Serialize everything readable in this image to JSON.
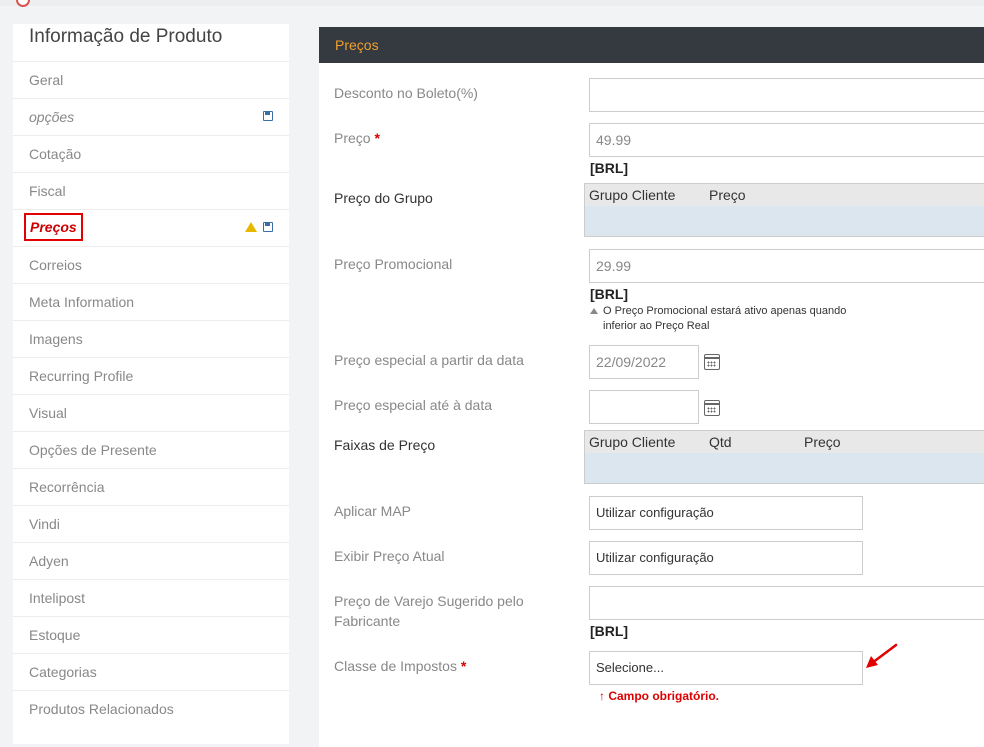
{
  "sidebar": {
    "title": "Informação de Produto",
    "items": [
      {
        "label": "Geral"
      },
      {
        "label": "opções"
      },
      {
        "label": "Cotação"
      },
      {
        "label": "Fiscal"
      },
      {
        "label": "Preços"
      },
      {
        "label": "Correios"
      },
      {
        "label": "Meta Information"
      },
      {
        "label": "Imagens"
      },
      {
        "label": "Recurring Profile"
      },
      {
        "label": "Visual"
      },
      {
        "label": "Opções de Presente"
      },
      {
        "label": "Recorrência"
      },
      {
        "label": "Vindi"
      },
      {
        "label": "Adyen"
      },
      {
        "label": "Intelipost"
      },
      {
        "label": "Estoque"
      },
      {
        "label": "Categorias"
      },
      {
        "label": "Produtos Relacionados"
      }
    ]
  },
  "panel": {
    "title": "Preços",
    "fields": {
      "desconto_boleto": {
        "label": "Desconto no Boleto(%)",
        "value": ""
      },
      "preco": {
        "label": "Preço",
        "required": "*",
        "value": "49.99",
        "currency": "[BRL]"
      },
      "preco_grupo": {
        "label": "Preço do Grupo",
        "col1": "Grupo Cliente",
        "col2": "Preço"
      },
      "preco_promocional": {
        "label": "Preço Promocional",
        "value": "29.99",
        "currency": "[BRL]",
        "note": "O Preço Promocional estará ativo apenas quando inferior ao Preço Real"
      },
      "preco_especial_de": {
        "label": "Preço especial a partir da data",
        "value": "22/09/2022"
      },
      "preco_especial_ate": {
        "label": "Preço especial até à data",
        "value": ""
      },
      "faixas_preco": {
        "label": "Faixas de Preço",
        "col1": "Grupo Cliente",
        "col2": "Qtd",
        "col3": "Preço"
      },
      "aplicar_map": {
        "label": "Aplicar MAP",
        "value": "Utilizar configuração"
      },
      "exibir_preco_atual": {
        "label": "Exibir Preço Atual",
        "value": "Utilizar configuração"
      },
      "preco_varejo": {
        "label": "Preço de Varejo Sugerido pelo Fabricante",
        "value": "",
        "currency": "[BRL]"
      },
      "classe_impostos": {
        "label": "Classe de Impostos",
        "required": "*",
        "value": "Selecione...",
        "error": "Campo obrigatório."
      }
    }
  },
  "colors": {
    "header_bg": "#343a40",
    "header_text": "#f0a030",
    "error": "#dd0000",
    "highlight": "#e30000"
  }
}
